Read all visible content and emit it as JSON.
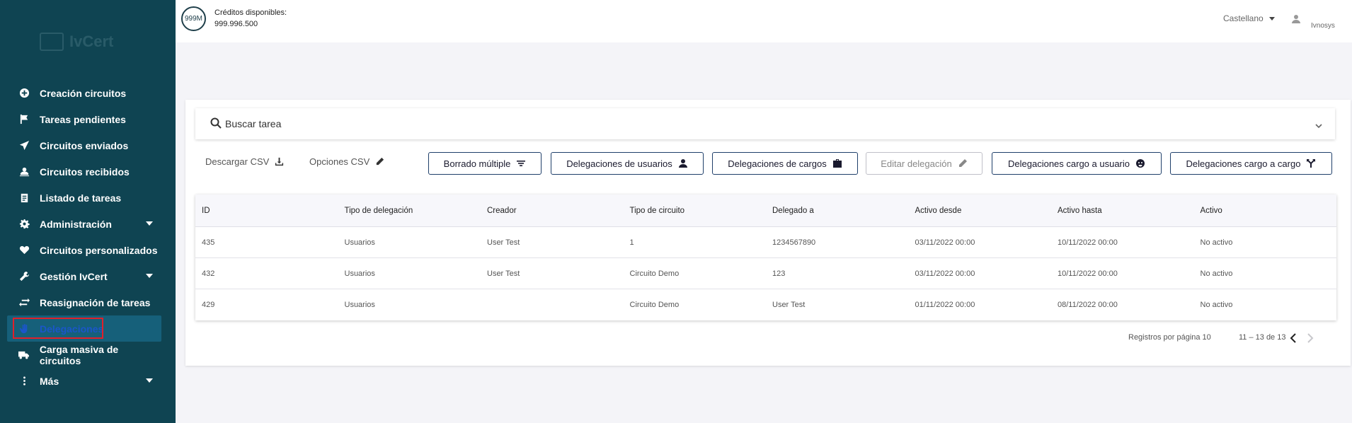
{
  "sidebar": {
    "items": [
      {
        "label": "Creación circuitos",
        "icon": "plus-circle-icon"
      },
      {
        "label": "Tareas pendientes",
        "icon": "flag-icon"
      },
      {
        "label": "Circuitos enviados",
        "icon": "send-icon"
      },
      {
        "label": "Circuitos recibidos",
        "icon": "inbox-user-icon"
      },
      {
        "label": "Listado de tareas",
        "icon": "clipboard-list-icon"
      },
      {
        "label": "Administración",
        "icon": "gear-icon"
      },
      {
        "label": "Circuitos personalizados",
        "icon": "heart-icon"
      },
      {
        "label": "Gestión IvCert",
        "icon": "wrench-icon"
      },
      {
        "label": "Reasignación de tareas",
        "icon": "swap-arrows-icon"
      },
      {
        "label": "Delegaciones",
        "icon": "hand-icon"
      },
      {
        "label": "Carga masiva de circuitos",
        "icon": "truck-icon"
      },
      {
        "label": "Más",
        "icon": "more-vertical-icon"
      }
    ],
    "active_item": "Delegaciones"
  },
  "header": {
    "credits_badge": "999M",
    "credits_label": "Créditos disponibles:",
    "credits_value": "999.996.500",
    "language": "Castellano",
    "user_name": "Ivnosys"
  },
  "search": {
    "placeholder": "Buscar tarea"
  },
  "toolbar": {
    "download_csv": "Descargar CSV",
    "csv_options": "Opciones CSV",
    "buttons": [
      {
        "label": "Borrado múltiple",
        "icon": "filter-lines-icon"
      },
      {
        "label": "Delegaciones de usuarios",
        "icon": "person-icon"
      },
      {
        "label": "Delegaciones de cargos",
        "icon": "briefcase-icon"
      },
      {
        "label": "Editar delegación",
        "icon": "pencil-icon"
      },
      {
        "label": "Delegaciones cargo a usuario",
        "icon": "face-icon"
      },
      {
        "label": "Delegaciones cargo a cargo",
        "icon": "merge-icon"
      }
    ]
  },
  "table": {
    "columns": [
      "ID",
      "Tipo de delegación",
      "Creador",
      "Tipo de circuito",
      "Delegado a",
      "Activo desde",
      "Activo hasta",
      "Activo"
    ],
    "rows": [
      [
        "435",
        "Usuarios",
        "User Test",
        "1",
        "1234567890",
        "03/11/2022 00:00",
        "10/11/2022 00:00",
        "No activo"
      ],
      [
        "432",
        "Usuarios",
        "User Test",
        "Circuito Demo",
        "123",
        "03/11/2022 00:00",
        "10/11/2022 00:00",
        "No activo"
      ],
      [
        "429",
        "Usuarios",
        "",
        "Circuito Demo",
        "User Test",
        "01/11/2022 00:00",
        "08/11/2022 00:00",
        "No activo"
      ]
    ]
  },
  "pagination": {
    "rows_per_page": "Registros por página 10",
    "range": "11 – 13 de 13"
  }
}
